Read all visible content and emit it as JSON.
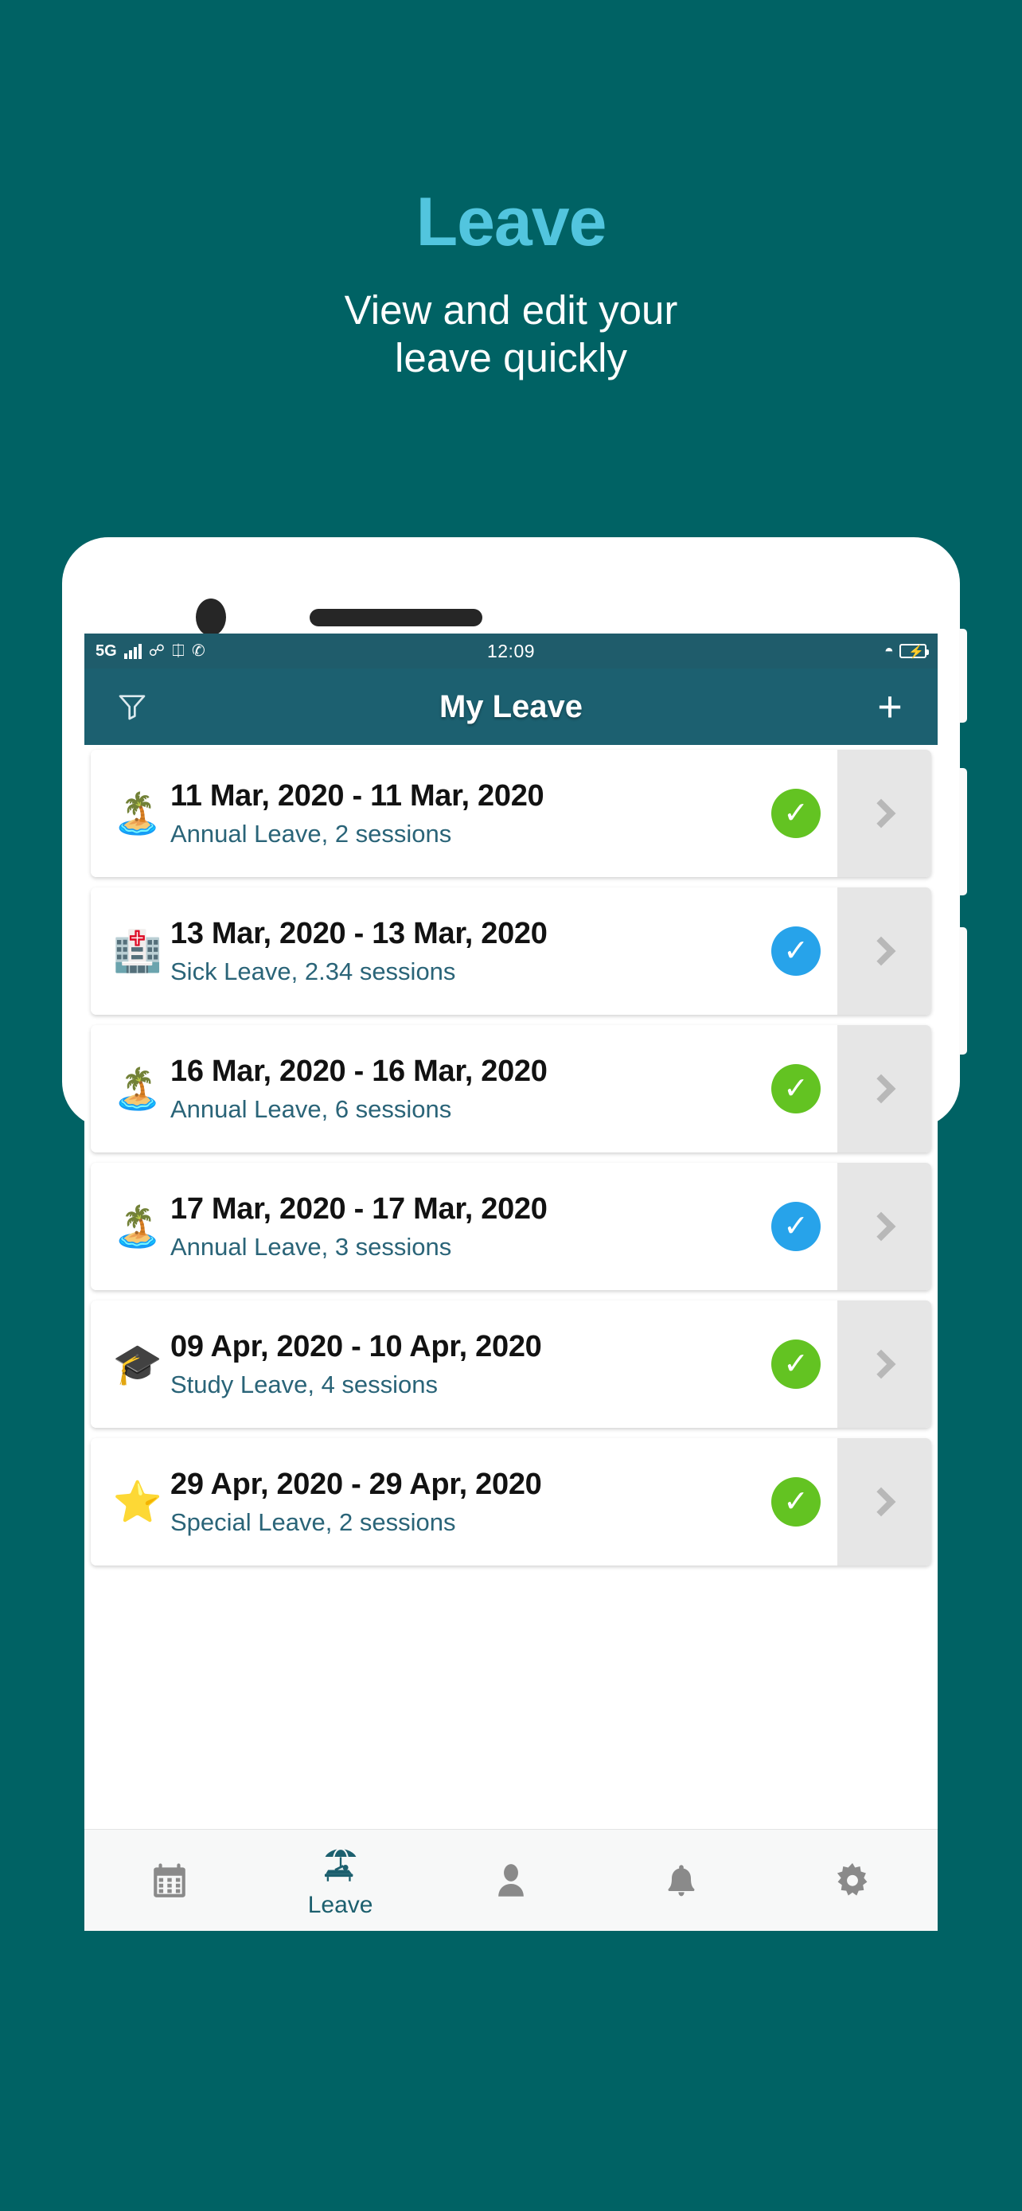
{
  "promo": {
    "title": "Leave",
    "subtitle_line1": "View and edit your",
    "subtitle_line2": "leave quickly",
    "title_color": "#52c5de",
    "background_color": "#006264"
  },
  "status_bar": {
    "network": "5G",
    "time": "12:09",
    "icons": [
      "signal-bars-icon",
      "usb-icon",
      "vpn-icon",
      "whatsapp-icon",
      "wifi-icon",
      "battery-charging-icon"
    ]
  },
  "app_bar": {
    "title": "My Leave",
    "filter_icon": "filter-funnel-icon",
    "add_icon": "plus-icon",
    "background_color": "#1c6070"
  },
  "list": {
    "rows": [
      {
        "emoji": "🏝️",
        "emoji_name": "palm-tree-icon",
        "dates": "11 Mar, 2020 - 11 Mar, 2020",
        "meta": "Annual Leave, 2 sessions",
        "status": "approved",
        "status_color": "#63c322",
        "chevron": "chevron-right-icon"
      },
      {
        "emoji": "🏥",
        "emoji_name": "hospital-icon",
        "dates": "13 Mar, 2020 - 13 Mar, 2020",
        "meta": "Sick Leave, 2.34 sessions",
        "status": "pending",
        "status_color": "#27a3ea",
        "chevron": "chevron-right-icon"
      },
      {
        "emoji": "🏝️",
        "emoji_name": "palm-tree-icon",
        "dates": "16 Mar, 2020 - 16 Mar, 2020",
        "meta": "Annual Leave, 6 sessions",
        "status": "approved",
        "status_color": "#63c322",
        "chevron": "chevron-right-icon"
      },
      {
        "emoji": "🏝️",
        "emoji_name": "palm-tree-icon",
        "dates": "17 Mar, 2020 - 17 Mar, 2020",
        "meta": "Annual Leave, 3 sessions",
        "status": "pending",
        "status_color": "#27a3ea",
        "chevron": "chevron-right-icon"
      },
      {
        "emoji": "🎓",
        "emoji_name": "graduation-cap-icon",
        "dates": "09 Apr, 2020 - 10 Apr, 2020",
        "meta": "Study Leave, 4 sessions",
        "status": "approved",
        "status_color": "#63c322",
        "chevron": "chevron-right-icon"
      },
      {
        "emoji": "⭐",
        "emoji_name": "star-icon",
        "dates": "29 Apr, 2020 - 29 Apr, 2020",
        "meta": "Special Leave, 2 sessions",
        "status": "approved",
        "status_color": "#63c322",
        "chevron": "chevron-right-icon"
      }
    ],
    "check_glyph": "✓"
  },
  "bottom_nav": {
    "items": [
      {
        "icon": "calendar-icon",
        "label": ""
      },
      {
        "icon": "beach-umbrella-icon",
        "label": "Leave"
      },
      {
        "icon": "person-icon",
        "label": ""
      },
      {
        "icon": "bell-icon",
        "label": ""
      },
      {
        "icon": "gear-icon",
        "label": ""
      }
    ],
    "active_index": 1,
    "active_color": "#1c5f6e",
    "inactive_color": "#8a8a8a"
  }
}
